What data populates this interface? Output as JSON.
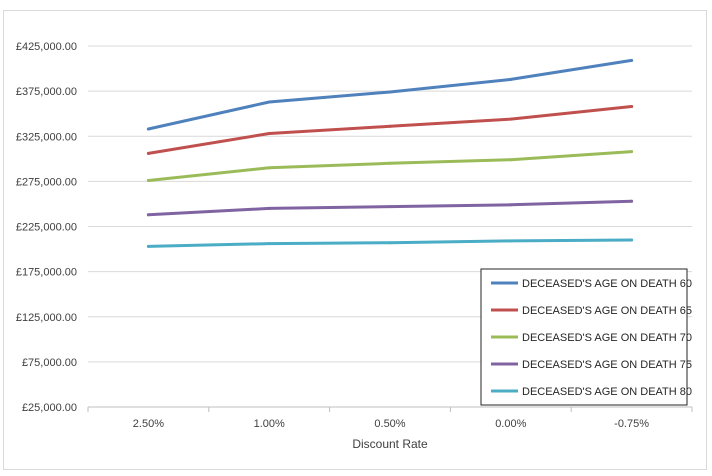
{
  "chart_data": {
    "type": "line",
    "title": "",
    "xlabel": "Discount Rate",
    "ylabel": "",
    "categories": [
      "2.50%",
      "1.00%",
      "0.50%",
      "0.00%",
      "-0.75%"
    ],
    "ylim": [
      25000,
      425000
    ],
    "yticks": [
      25000,
      75000,
      125000,
      175000,
      225000,
      275000,
      325000,
      375000,
      425000
    ],
    "ytick_labels": [
      "£25,000.00",
      "£75,000.00",
      "£125,000.00",
      "£175,000.00",
      "£225,000.00",
      "£275,000.00",
      "£325,000.00",
      "£375,000.00",
      "£425,000.00"
    ],
    "grid": true,
    "legend_position": "bottom-right",
    "series": [
      {
        "name": "DECEASED'S AGE ON DEATH 60",
        "color": "#4f81bd",
        "values": [
          333000,
          363000,
          374000,
          388000,
          409000
        ]
      },
      {
        "name": "DECEASED'S AGE ON DEATH 65",
        "color": "#c0504d",
        "values": [
          306000,
          328000,
          336000,
          344000,
          358000
        ]
      },
      {
        "name": "DECEASED'S AGE ON DEATH 70",
        "color": "#9bbb59",
        "values": [
          276000,
          290000,
          295000,
          299000,
          308000
        ]
      },
      {
        "name": "DECEASED'S AGE ON DEATH 75",
        "color": "#8064a2",
        "values": [
          238000,
          245000,
          247000,
          249000,
          253000
        ]
      },
      {
        "name": "DECEASED'S AGE ON DEATH 80",
        "color": "#4bacc6",
        "values": [
          203000,
          206000,
          207000,
          209000,
          210000
        ]
      }
    ]
  }
}
